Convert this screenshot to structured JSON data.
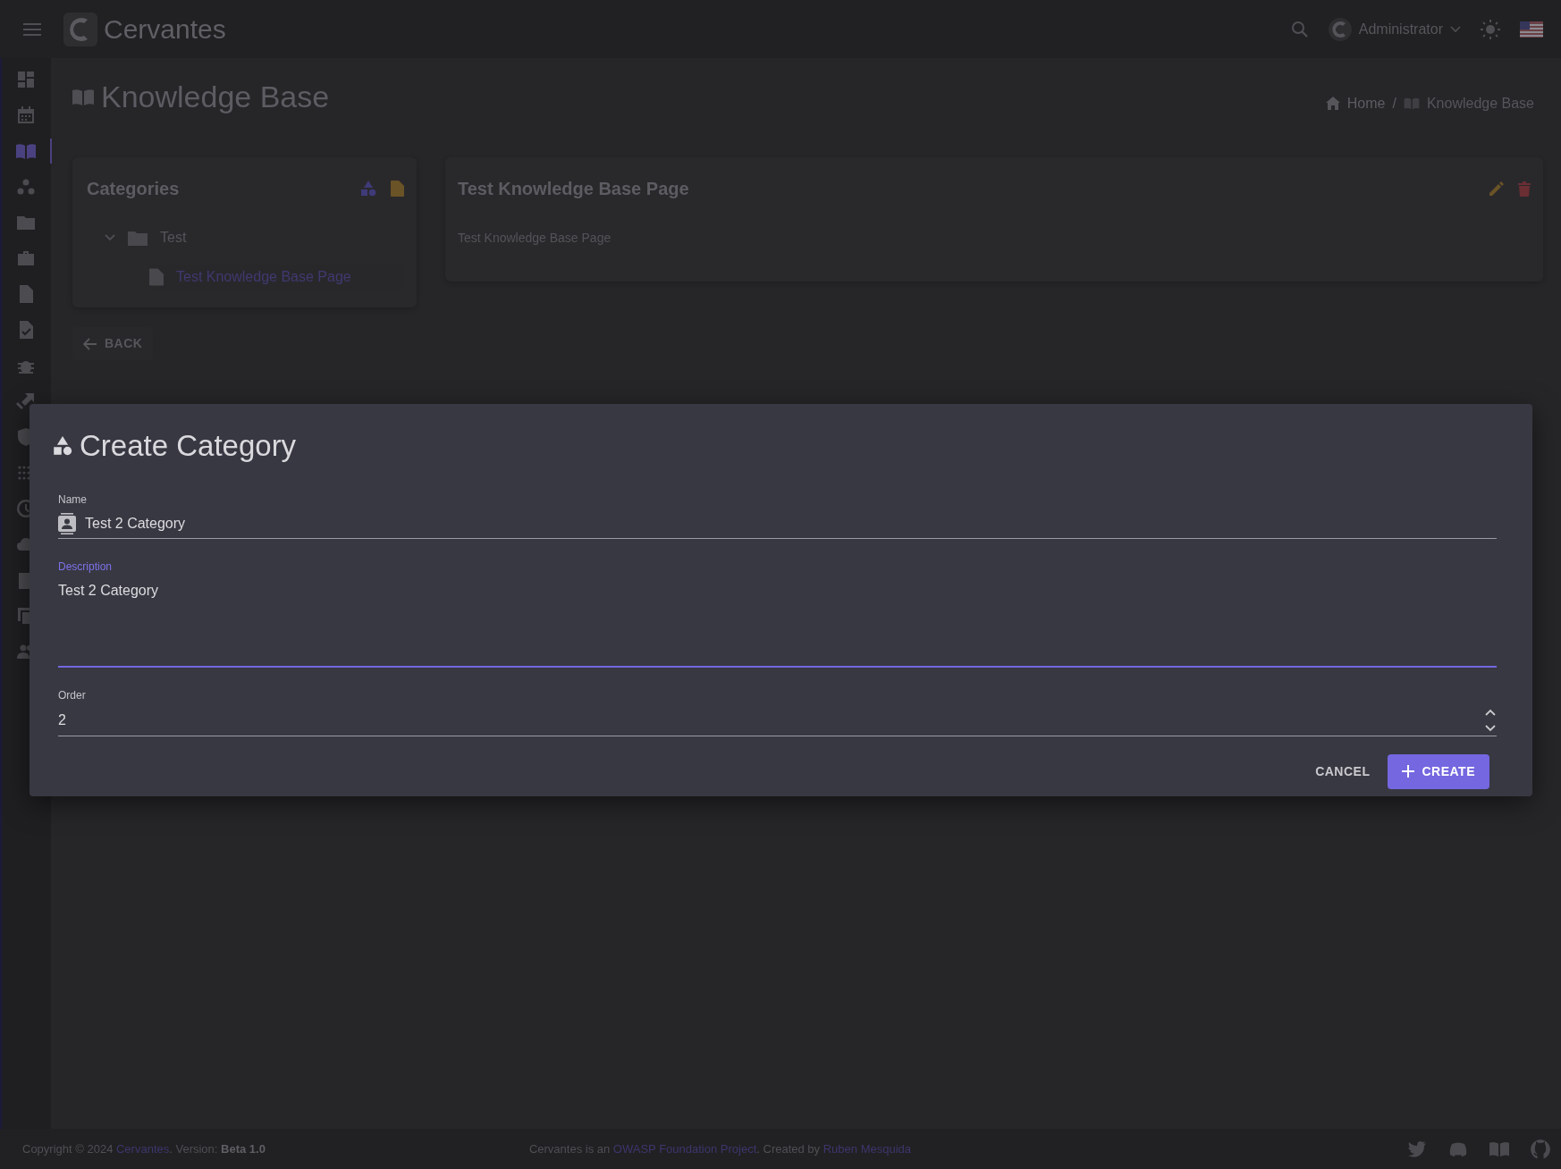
{
  "app": {
    "title": "Cervantes",
    "user": "Administrator"
  },
  "sidebar": {
    "items": [
      {
        "selected": false
      },
      {
        "selected": false
      },
      {
        "selected": true
      },
      {
        "selected": false
      },
      {
        "selected": false
      },
      {
        "selected": false
      },
      {
        "selected": false
      },
      {
        "selected": false
      },
      {
        "selected": false
      },
      {
        "selected": false
      },
      {
        "selected": false
      },
      {
        "selected": false
      },
      {
        "selected": false
      },
      {
        "selected": false
      },
      {
        "selected": false
      },
      {
        "selected": false
      },
      {
        "selected": false
      }
    ]
  },
  "page": {
    "title": "Knowledge Base",
    "separator": "/",
    "breadcrumbs": [
      {
        "label": "Home"
      },
      {
        "label": "Knowledge Base"
      }
    ]
  },
  "categories": {
    "title": "Categories",
    "tree": [
      {
        "label": "Test",
        "expanded": true,
        "children": [
          {
            "label": "Test Knowledge Base Page",
            "selected": true
          }
        ]
      }
    ]
  },
  "article": {
    "title": "Test Knowledge Base Page",
    "body": "Test Knowledge Base Page"
  },
  "back_button": "BACK",
  "dialog": {
    "title": "Create Category",
    "fields": [
      {
        "kind": "text",
        "label": "Name",
        "value": "Test 2 Category",
        "focused": false
      },
      {
        "kind": "textarea",
        "label": "Description",
        "value": "Test 2 Category",
        "focused": true
      },
      {
        "kind": "number",
        "label": "Order",
        "value": "2",
        "focused": false
      }
    ],
    "buttons": [
      {
        "kind": "text",
        "label": "CANCEL"
      },
      {
        "kind": "primary",
        "label": "CREATE"
      }
    ]
  },
  "footer": {
    "copyright": {
      "before": "Copyright © 2024",
      "link": "Cervantes",
      "after": ". Version: **Beta 1.0**"
    },
    "credits": [
      {
        "text": "Cervantes is an",
        "link": "OWASP Foundation Project"
      },
      {
        "text": ". Created by",
        "link": "Ruben Mesquida"
      }
    ]
  }
}
